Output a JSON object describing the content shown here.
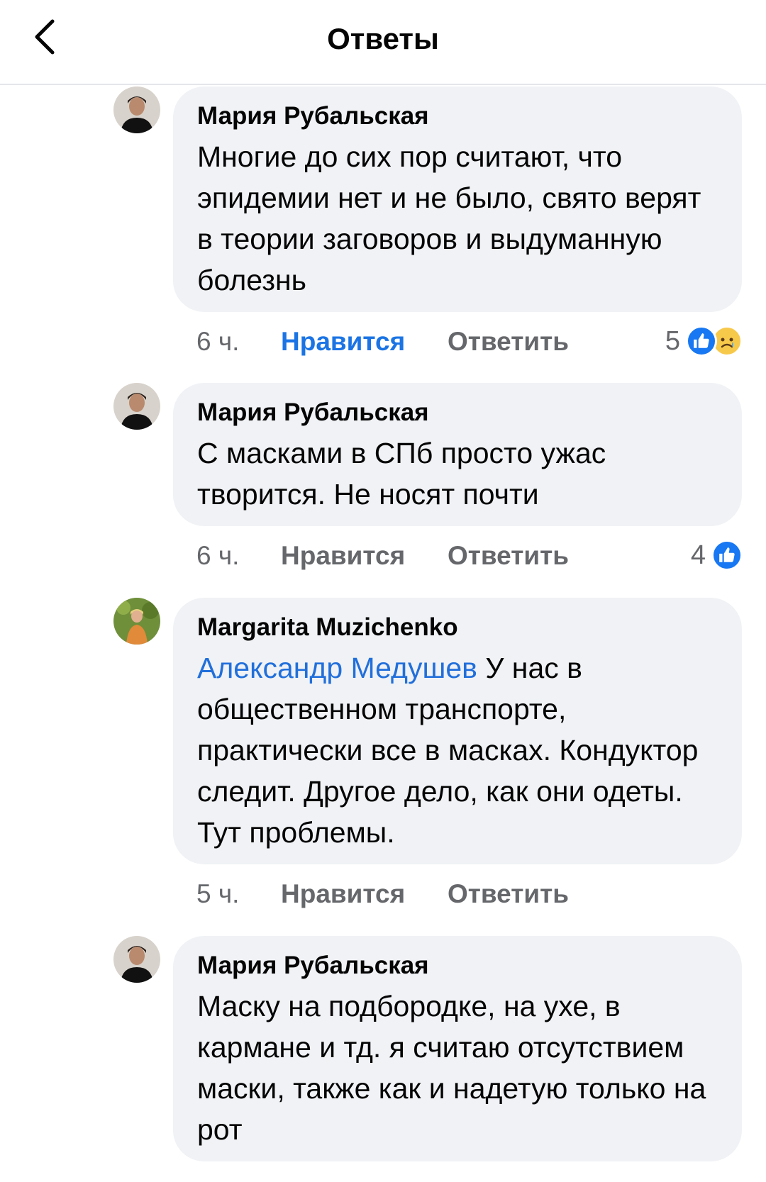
{
  "header": {
    "title": "Ответы",
    "back_icon": "chevron-left-icon"
  },
  "comments": [
    {
      "author": "Мария Рубальская",
      "mention": "",
      "text": "Многие до сих пор считают, что эпидемии нет и не было, свято верят в теории заговоров и выдуманную болезнь",
      "time": "6 ч.",
      "like_label": "Нравится",
      "reply_label": "Ответить",
      "liked": true,
      "reaction_count": "5",
      "reactions": [
        "like-icon",
        "sad-icon"
      ]
    },
    {
      "author": "Мария Рубальская",
      "mention": "",
      "text": "С масками в СПб просто ужас творится. Не носят почти",
      "time": "6 ч.",
      "like_label": "Нравится",
      "reply_label": "Ответить",
      "liked": false,
      "reaction_count": "4",
      "reactions": [
        "like-icon"
      ]
    },
    {
      "author": "Margarita Muzichenko",
      "mention": "Александр Медушев",
      "text": "У нас в общественном транспорте, практически все в масках. Кондуктор следит. Другое дело, как они одеты. Тут проблемы.",
      "time": "5 ч.",
      "like_label": "Нравится",
      "reply_label": "Ответить",
      "liked": false,
      "reaction_count": "",
      "reactions": []
    },
    {
      "author": "Мария Рубальская",
      "mention": "",
      "text": "Маску на подбородке, на ухе, в кармане и тд. я считаю отсутствием маски, также как и надетую только на рот",
      "time": "",
      "like_label": "",
      "reply_label": "",
      "liked": false,
      "reaction_count": "",
      "reactions": []
    }
  ],
  "colors": {
    "bubble_bg": "#f0f2f5",
    "accent_blue": "#1b74e4",
    "mention_blue": "#216fdb",
    "muted_text": "#65676b"
  }
}
